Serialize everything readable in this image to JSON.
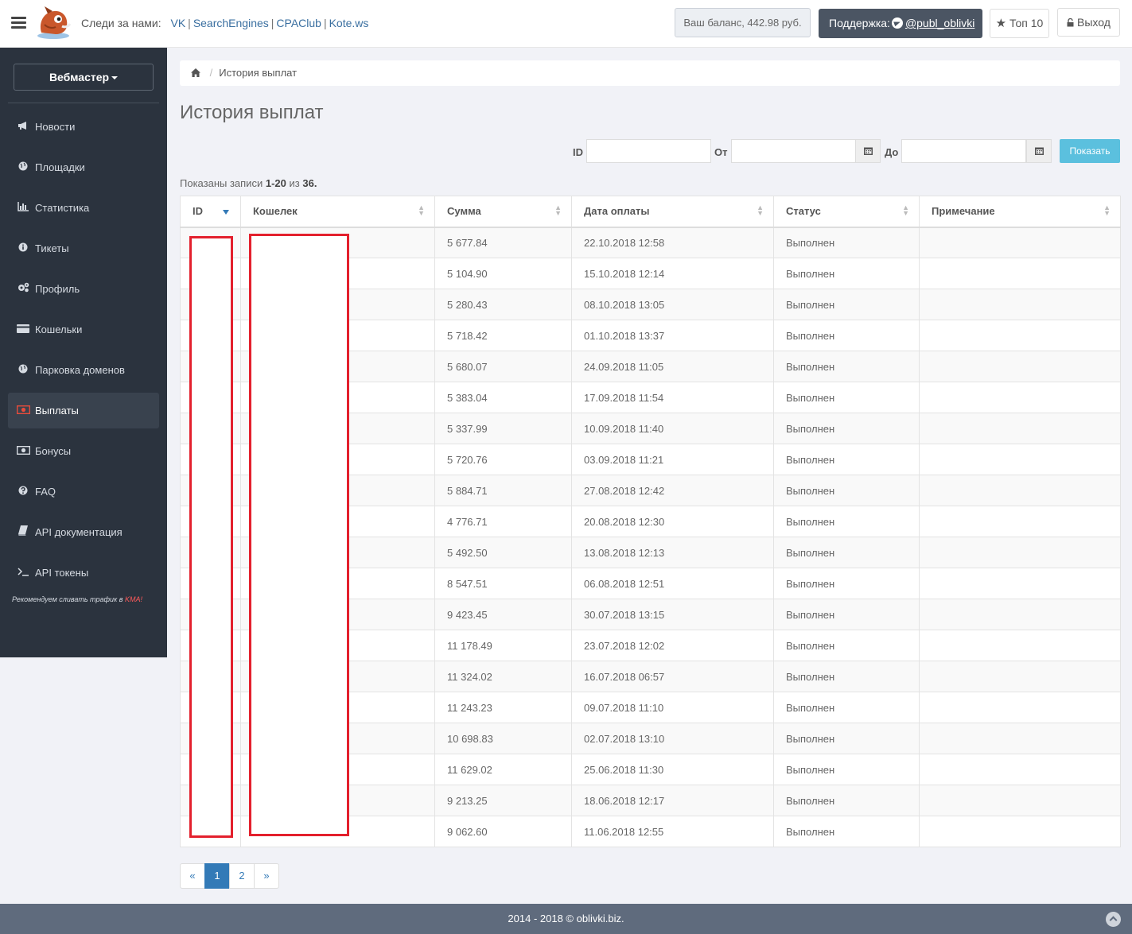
{
  "topbar": {
    "follow_label": "Следи за нами:",
    "links": [
      "VK",
      "SearchEngines",
      "CPAClub",
      "Kote.ws"
    ],
    "balance": "Ваш баланс, 442.98 руб.",
    "support_label": "Поддержка:",
    "support_handle": "@publ_oblivki",
    "top10": "Топ 10",
    "logout": "Выход"
  },
  "sidebar": {
    "role": "Вебмастер",
    "items": [
      {
        "label": "Новости",
        "icon": "megaphone-icon"
      },
      {
        "label": "Площадки",
        "icon": "globe-icon"
      },
      {
        "label": "Статистика",
        "icon": "bar-chart-icon"
      },
      {
        "label": "Тикеты",
        "icon": "info-icon"
      },
      {
        "label": "Профиль",
        "icon": "cogs-icon"
      },
      {
        "label": "Кошельки",
        "icon": "credit-card-icon"
      },
      {
        "label": "Парковка доменов",
        "icon": "globe-icon"
      },
      {
        "label": "Выплаты",
        "icon": "money-icon"
      },
      {
        "label": "Бонусы",
        "icon": "money-icon"
      },
      {
        "label": "FAQ",
        "icon": "question-icon"
      },
      {
        "label": "API документация",
        "icon": "book-icon"
      },
      {
        "label": "API токены",
        "icon": "terminal-icon"
      }
    ],
    "active_index": 7,
    "note": "Рекомендуем сливать трафик в",
    "note_highlight": "KMA!"
  },
  "breadcrumb": {
    "current": "История выплат"
  },
  "page": {
    "title": "История выплат",
    "filter": {
      "id_label": "ID",
      "from_label": "От",
      "to_label": "До",
      "id_value": "",
      "from_value": "",
      "to_value": "",
      "show_button": "Показать"
    },
    "summary_prefix": "Показаны записи",
    "summary_range": "1-20",
    "summary_mid": "из",
    "summary_total": "36."
  },
  "table": {
    "headers": [
      "ID",
      "Кошелек",
      "Сумма",
      "Дата оплаты",
      "Статус",
      "Примечание"
    ],
    "rows": [
      {
        "sum": "5 677.84",
        "date": "22.10.2018 12:58",
        "status": "Выполнен"
      },
      {
        "sum": "5 104.90",
        "date": "15.10.2018 12:14",
        "status": "Выполнен"
      },
      {
        "sum": "5 280.43",
        "date": "08.10.2018 13:05",
        "status": "Выполнен"
      },
      {
        "sum": "5 718.42",
        "date": "01.10.2018 13:37",
        "status": "Выполнен"
      },
      {
        "sum": "5 680.07",
        "date": "24.09.2018 11:05",
        "status": "Выполнен"
      },
      {
        "sum": "5 383.04",
        "date": "17.09.2018 11:54",
        "status": "Выполнен"
      },
      {
        "sum": "5 337.99",
        "date": "10.09.2018 11:40",
        "status": "Выполнен"
      },
      {
        "sum": "5 720.76",
        "date": "03.09.2018 11:21",
        "status": "Выполнен"
      },
      {
        "sum": "5 884.71",
        "date": "27.08.2018 12:42",
        "status": "Выполнен"
      },
      {
        "sum": "4 776.71",
        "date": "20.08.2018 12:30",
        "status": "Выполнен"
      },
      {
        "sum": "5 492.50",
        "date": "13.08.2018 12:13",
        "status": "Выполнен"
      },
      {
        "sum": "8 547.51",
        "date": "06.08.2018 12:51",
        "status": "Выполнен"
      },
      {
        "sum": "9 423.45",
        "date": "30.07.2018 13:15",
        "status": "Выполнен"
      },
      {
        "sum": "11 178.49",
        "date": "23.07.2018 12:02",
        "status": "Выполнен"
      },
      {
        "sum": "11 324.02",
        "date": "16.07.2018 06:57",
        "status": "Выполнен"
      },
      {
        "sum": "11 243.23",
        "date": "09.07.2018 11:10",
        "status": "Выполнен"
      },
      {
        "sum": "10 698.83",
        "date": "02.07.2018 13:10",
        "status": "Выполнен"
      },
      {
        "sum": "11 629.02",
        "date": "25.06.2018 11:30",
        "status": "Выполнен"
      },
      {
        "sum": "9 213.25",
        "date": "18.06.2018 12:17",
        "status": "Выполнен"
      },
      {
        "sum": "9 062.60",
        "date": "11.06.2018 12:55",
        "status": "Выполнен"
      }
    ]
  },
  "pagination": {
    "prev": "«",
    "pages": [
      "1",
      "2"
    ],
    "active": "1",
    "next": "»"
  },
  "footer": {
    "text": "2014 - 2018 © oblivki.biz."
  },
  "colors": {
    "accent": "#337ab7",
    "sidebar": "#2b333e",
    "button_info": "#5bc0de",
    "redaction": "#e3202d"
  }
}
